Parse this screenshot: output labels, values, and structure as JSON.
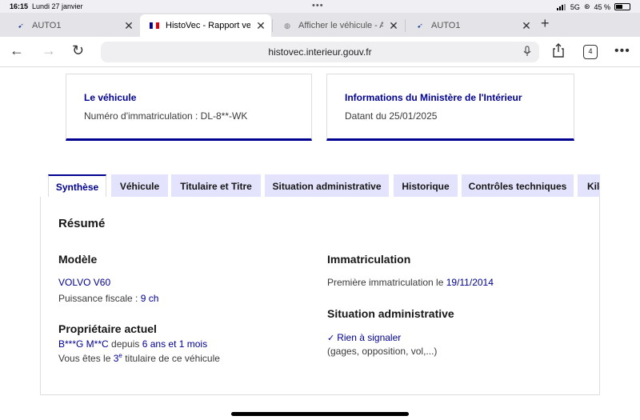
{
  "status_bar": {
    "time": "16:15",
    "date": "Lundi 27 janvier",
    "network": "5G",
    "battery": "45 %",
    "battery_level": 0.45
  },
  "browser_tabs": [
    {
      "title": "AUTO1",
      "favicon": "auto1-logo-icon",
      "active": false
    },
    {
      "title": "HistoVec - Rapport vendeur",
      "favicon": "french-flag-icon",
      "active": true
    },
    {
      "title": "Afficher le véhicule - Admin",
      "favicon": "globe-icon",
      "active": false
    },
    {
      "title": "AUTO1",
      "favicon": "auto1-logo-icon",
      "active": false
    }
  ],
  "toolbar": {
    "url": "histovec.interieur.gouv.fr",
    "tab_count": "4"
  },
  "cards": {
    "vehicle": {
      "title": "Le véhicule",
      "value": "Numéro d'immatriculation : DL-8**-WK"
    },
    "ministry": {
      "title": "Informations du Ministère de l'Intérieur",
      "value": "Datant du 25/01/2025"
    }
  },
  "page_tabs": [
    "Synthèse",
    "Véhicule",
    "Titulaire et Titre",
    "Situation administrative",
    "Historique",
    "Contrôles techniques",
    "Kilométrage"
  ],
  "summary": {
    "title": "Résumé",
    "model": {
      "heading": "Modèle",
      "name": "VOLVO V60",
      "power_label": "Puissance fiscale : ",
      "power_value": "9 ch"
    },
    "owner": {
      "heading": "Propriétaire actuel",
      "name": "B***G M**C",
      "since_label": " depuis ",
      "since_value": "6 ans et 1 mois",
      "rank_prefix": "Vous êtes le ",
      "rank_number": "3",
      "rank_sup": "e",
      "rank_suffix": " titulaire de ce véhicule"
    },
    "registration": {
      "heading": "Immatriculation",
      "first_label": "Première immatriculation le ",
      "first_date": "19/11/2014"
    },
    "admin_status": {
      "heading": "Situation administrative",
      "status": "Rien à signaler",
      "details": "(gages, opposition, vol,...)"
    }
  },
  "colors": {
    "primary": "#000091",
    "tab_inactive_bg": "#e3e3fd",
    "text": "#161616"
  }
}
